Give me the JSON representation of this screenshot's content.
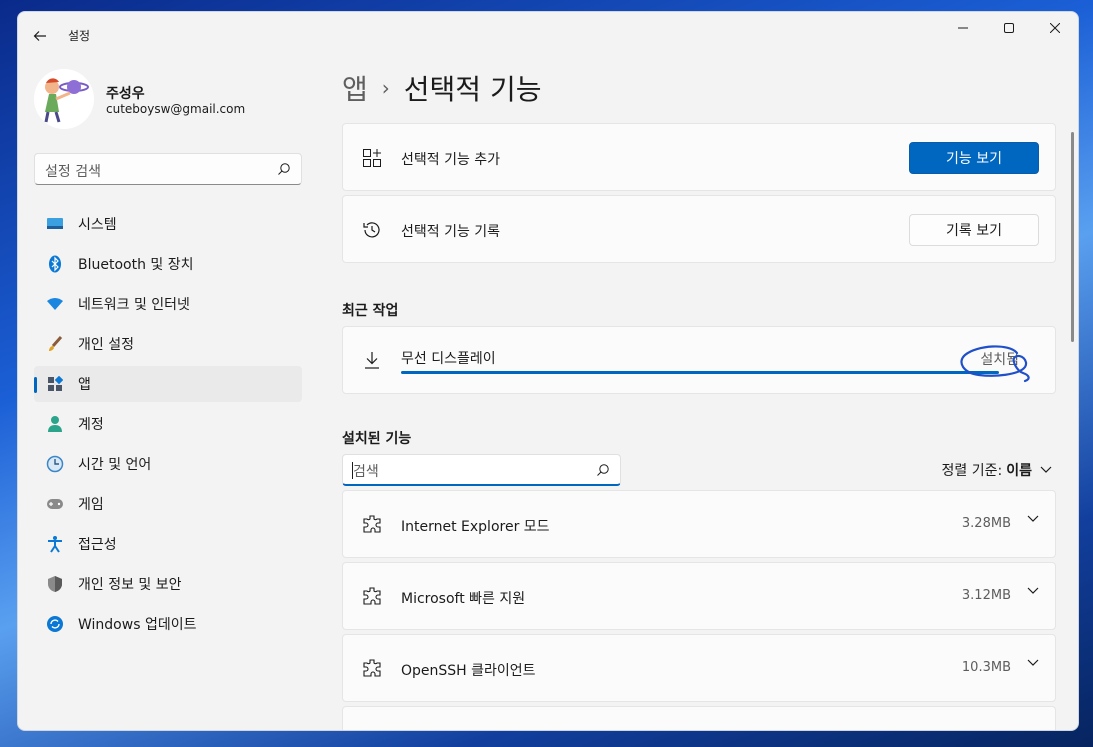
{
  "window": {
    "title": "설정"
  },
  "profile": {
    "name": "주성우",
    "email": "cuteboysw@gmail.com"
  },
  "search": {
    "placeholder": "설정 검색"
  },
  "nav": {
    "items": [
      {
        "label": "시스템",
        "icon": "system-icon"
      },
      {
        "label": "Bluetooth 및 장치",
        "icon": "bluetooth-icon"
      },
      {
        "label": "네트워크 및 인터넷",
        "icon": "wifi-icon"
      },
      {
        "label": "개인 설정",
        "icon": "brush-icon"
      },
      {
        "label": "앱",
        "icon": "apps-icon",
        "active": true
      },
      {
        "label": "계정",
        "icon": "person-icon"
      },
      {
        "label": "시간 및 언어",
        "icon": "globe-clock-icon"
      },
      {
        "label": "게임",
        "icon": "gamepad-icon"
      },
      {
        "label": "접근성",
        "icon": "accessibility-icon"
      },
      {
        "label": "개인 정보 및 보안",
        "icon": "shield-icon"
      },
      {
        "label": "Windows 업데이트",
        "icon": "update-icon"
      }
    ]
  },
  "breadcrumb": {
    "parent": "앱",
    "separator": "›",
    "current": "선택적 기능"
  },
  "add_feature": {
    "label": "선택적 기능 추가",
    "button": "기능 보기"
  },
  "history": {
    "label": "선택적 기능 기록",
    "button": "기록 보기"
  },
  "recent": {
    "title": "최근 작업",
    "item": {
      "label": "무선 디스플레이",
      "status": "설치됨",
      "progress": 1.0
    }
  },
  "installed": {
    "title": "설치된 기능",
    "search_placeholder": "검색",
    "sort_label": "정렬 기준:",
    "sort_value": "이름",
    "features": [
      {
        "name": "Internet Explorer 모드",
        "size": "3.28MB"
      },
      {
        "name": "Microsoft 빠른 지원",
        "size": "3.12MB"
      },
      {
        "name": "OpenSSH 클라이언트",
        "size": "10.3MB"
      }
    ]
  },
  "colors": {
    "accent": "#0067c0",
    "window_bg": "#f3f3f3",
    "card_bg": "#fbfbfb"
  }
}
